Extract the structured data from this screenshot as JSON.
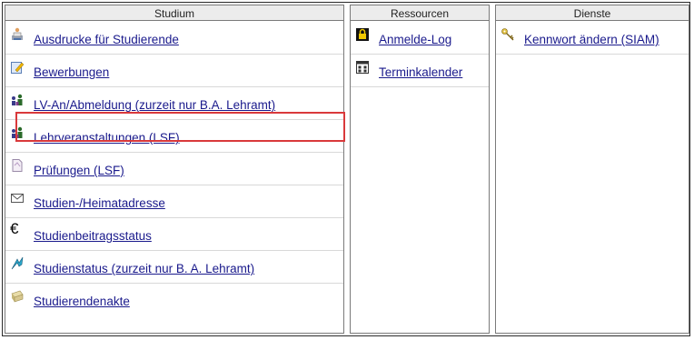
{
  "headers": {
    "studium": "Studium",
    "ressourcen": "Ressourcen",
    "dienste": "Dienste"
  },
  "studium": [
    {
      "label": "Ausdrucke für Studierende",
      "icon": "printer-person-icon"
    },
    {
      "label": "Bewerbungen",
      "icon": "edit-form-icon"
    },
    {
      "label": "LV-An/Abmeldung (zurzeit nur B.A. Lehramt)",
      "icon": "group-people-icon"
    },
    {
      "label": "Lehrveranstaltungen (LSF)",
      "icon": "group-people-icon"
    },
    {
      "label": "Prüfungen (LSF)",
      "icon": "document-icon"
    },
    {
      "label": "Studien-/Heimatadresse",
      "icon": "envelope-icon"
    },
    {
      "label": "Studienbeitragsstatus",
      "icon": "euro-icon"
    },
    {
      "label": "Studienstatus (zurzeit nur B. A. Lehramt)",
      "icon": "status-arrow-icon"
    },
    {
      "label": "Studierendenakte",
      "icon": "folder-stack-icon"
    }
  ],
  "ressourcen": [
    {
      "label": "Anmelde-Log",
      "icon": "lock-icon"
    },
    {
      "label": "Terminkalender",
      "icon": "calendar-icon"
    }
  ],
  "dienste": [
    {
      "label": "Kennwort ändern (SIAM)",
      "icon": "keys-icon"
    }
  ],
  "highlight_color": "#d9393b",
  "link_color": "#1a1a8c"
}
